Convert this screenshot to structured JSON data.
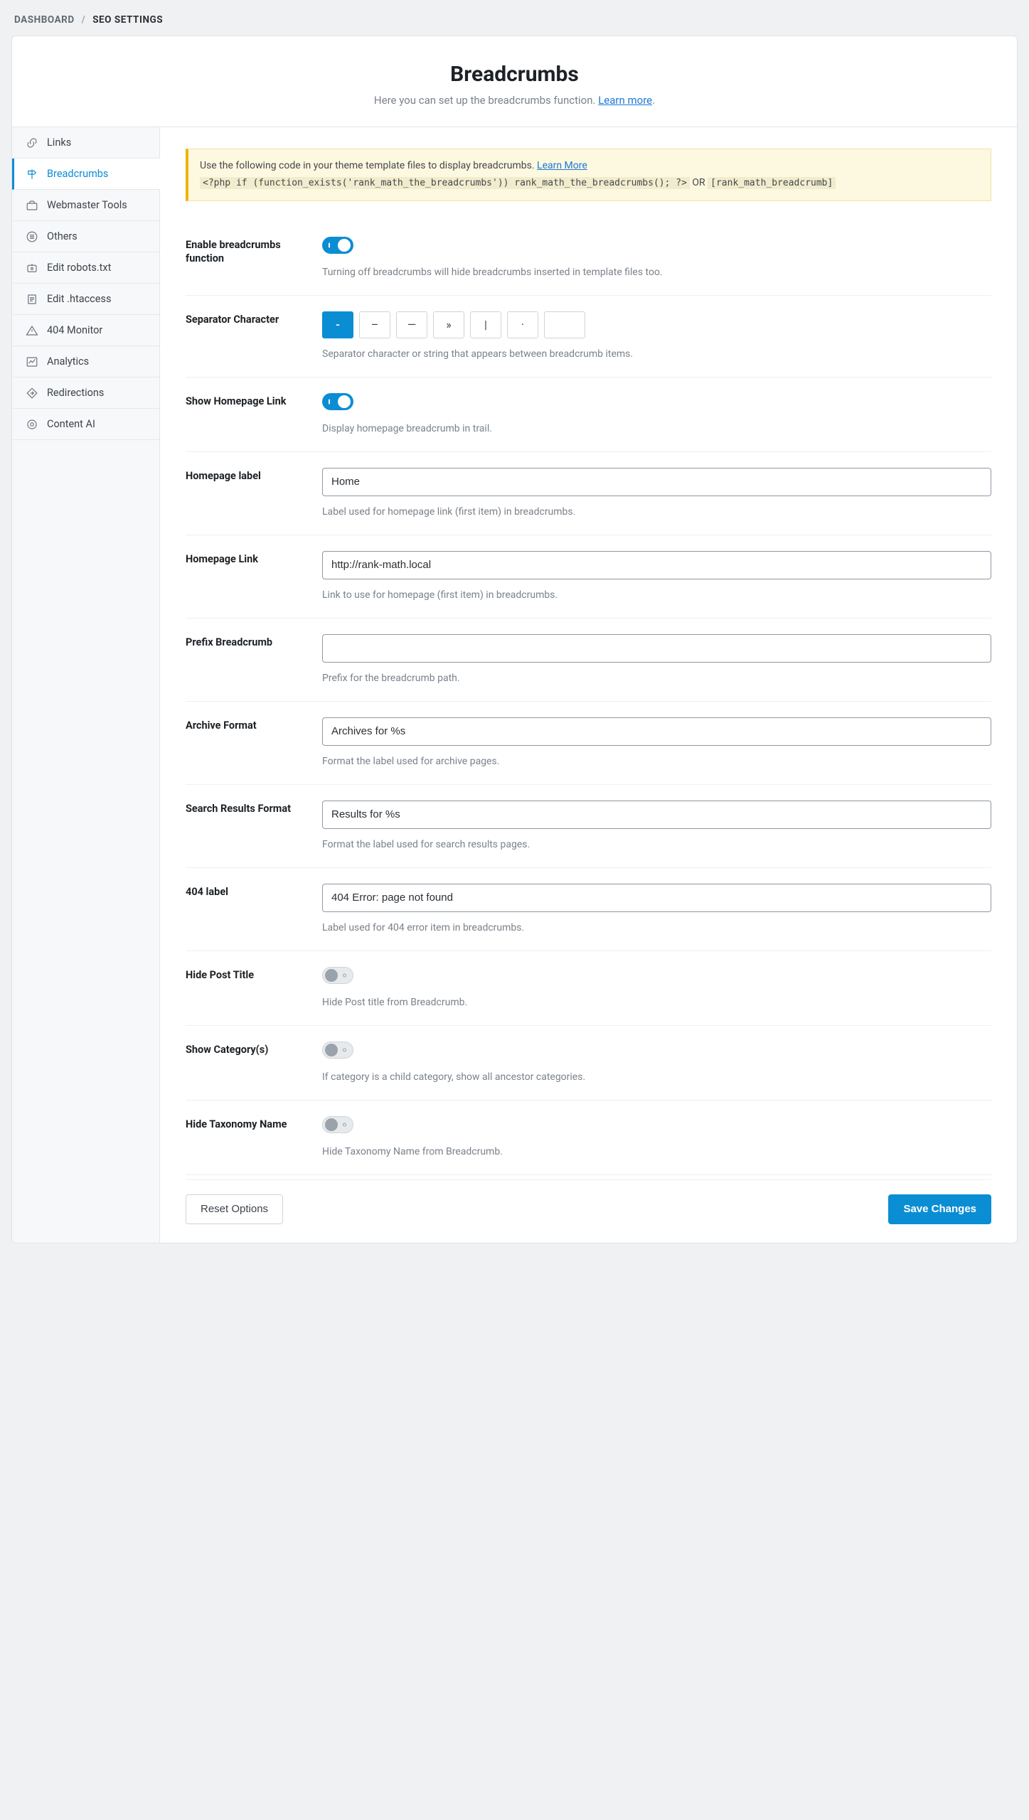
{
  "breadcrumb": {
    "root": "DASHBOARD",
    "sep": "/",
    "current": "SEO SETTINGS"
  },
  "header": {
    "title": "Breadcrumbs",
    "subtitle_pre": "Here you can set up the breadcrumbs function. ",
    "subtitle_link": "Learn more",
    "subtitle_post": "."
  },
  "sidebar": {
    "items": [
      {
        "label": "Links",
        "icon": "link"
      },
      {
        "label": "Breadcrumbs",
        "icon": "signpost",
        "active": true
      },
      {
        "label": "Webmaster Tools",
        "icon": "briefcase"
      },
      {
        "label": "Others",
        "icon": "list"
      },
      {
        "label": "Edit robots.txt",
        "icon": "robot"
      },
      {
        "label": "Edit .htaccess",
        "icon": "file"
      },
      {
        "label": "404 Monitor",
        "icon": "warning"
      },
      {
        "label": "Analytics",
        "icon": "chart"
      },
      {
        "label": "Redirections",
        "icon": "redirect"
      },
      {
        "label": "Content AI",
        "icon": "ai"
      }
    ]
  },
  "notice": {
    "text": "Use the following code in your theme template files to display breadcrumbs. ",
    "link": "Learn More",
    "code": "<?php if (function_exists('rank_math_the_breadcrumbs')) rank_math_the_breadcrumbs(); ?>",
    "or": " OR ",
    "shortcode": "[rank_math_breadcrumb]"
  },
  "fields": {
    "enable": {
      "label": "Enable breadcrumbs function",
      "on": true,
      "hint": "Turning off breadcrumbs will hide breadcrumbs inserted in template files too."
    },
    "separator": {
      "label": "Separator Character",
      "options": [
        "-",
        "–",
        "—",
        "»",
        "|",
        "·",
        ""
      ],
      "selected_index": 0,
      "hint": "Separator character or string that appears between breadcrumb items."
    },
    "show_home": {
      "label": "Show Homepage Link",
      "on": true,
      "hint": "Display homepage breadcrumb in trail."
    },
    "home_label": {
      "label": "Homepage label",
      "value": "Home",
      "hint": "Label used for homepage link (first item) in breadcrumbs."
    },
    "home_link": {
      "label": "Homepage Link",
      "value": "http://rank-math.local",
      "hint": "Link to use for homepage (first item) in breadcrumbs."
    },
    "prefix": {
      "label": "Prefix Breadcrumb",
      "value": "",
      "hint": "Prefix for the breadcrumb path."
    },
    "archive": {
      "label": "Archive Format",
      "value": "Archives for %s",
      "hint": "Format the label used for archive pages."
    },
    "search": {
      "label": "Search Results Format",
      "value": "Results for %s",
      "hint": "Format the label used for search results pages."
    },
    "label404": {
      "label": "404 label",
      "value": "404 Error: page not found",
      "hint": "Label used for 404 error item in breadcrumbs."
    },
    "hide_post": {
      "label": "Hide Post Title",
      "on": false,
      "hint": "Hide Post title from Breadcrumb."
    },
    "show_cat": {
      "label": "Show Category(s)",
      "on": false,
      "hint": "If category is a child category, show all ancestor categories."
    },
    "hide_tax": {
      "label": "Hide Taxonomy Name",
      "on": false,
      "hint": "Hide Taxonomy Name from Breadcrumb."
    }
  },
  "footer": {
    "reset": "Reset Options",
    "save": "Save Changes"
  }
}
